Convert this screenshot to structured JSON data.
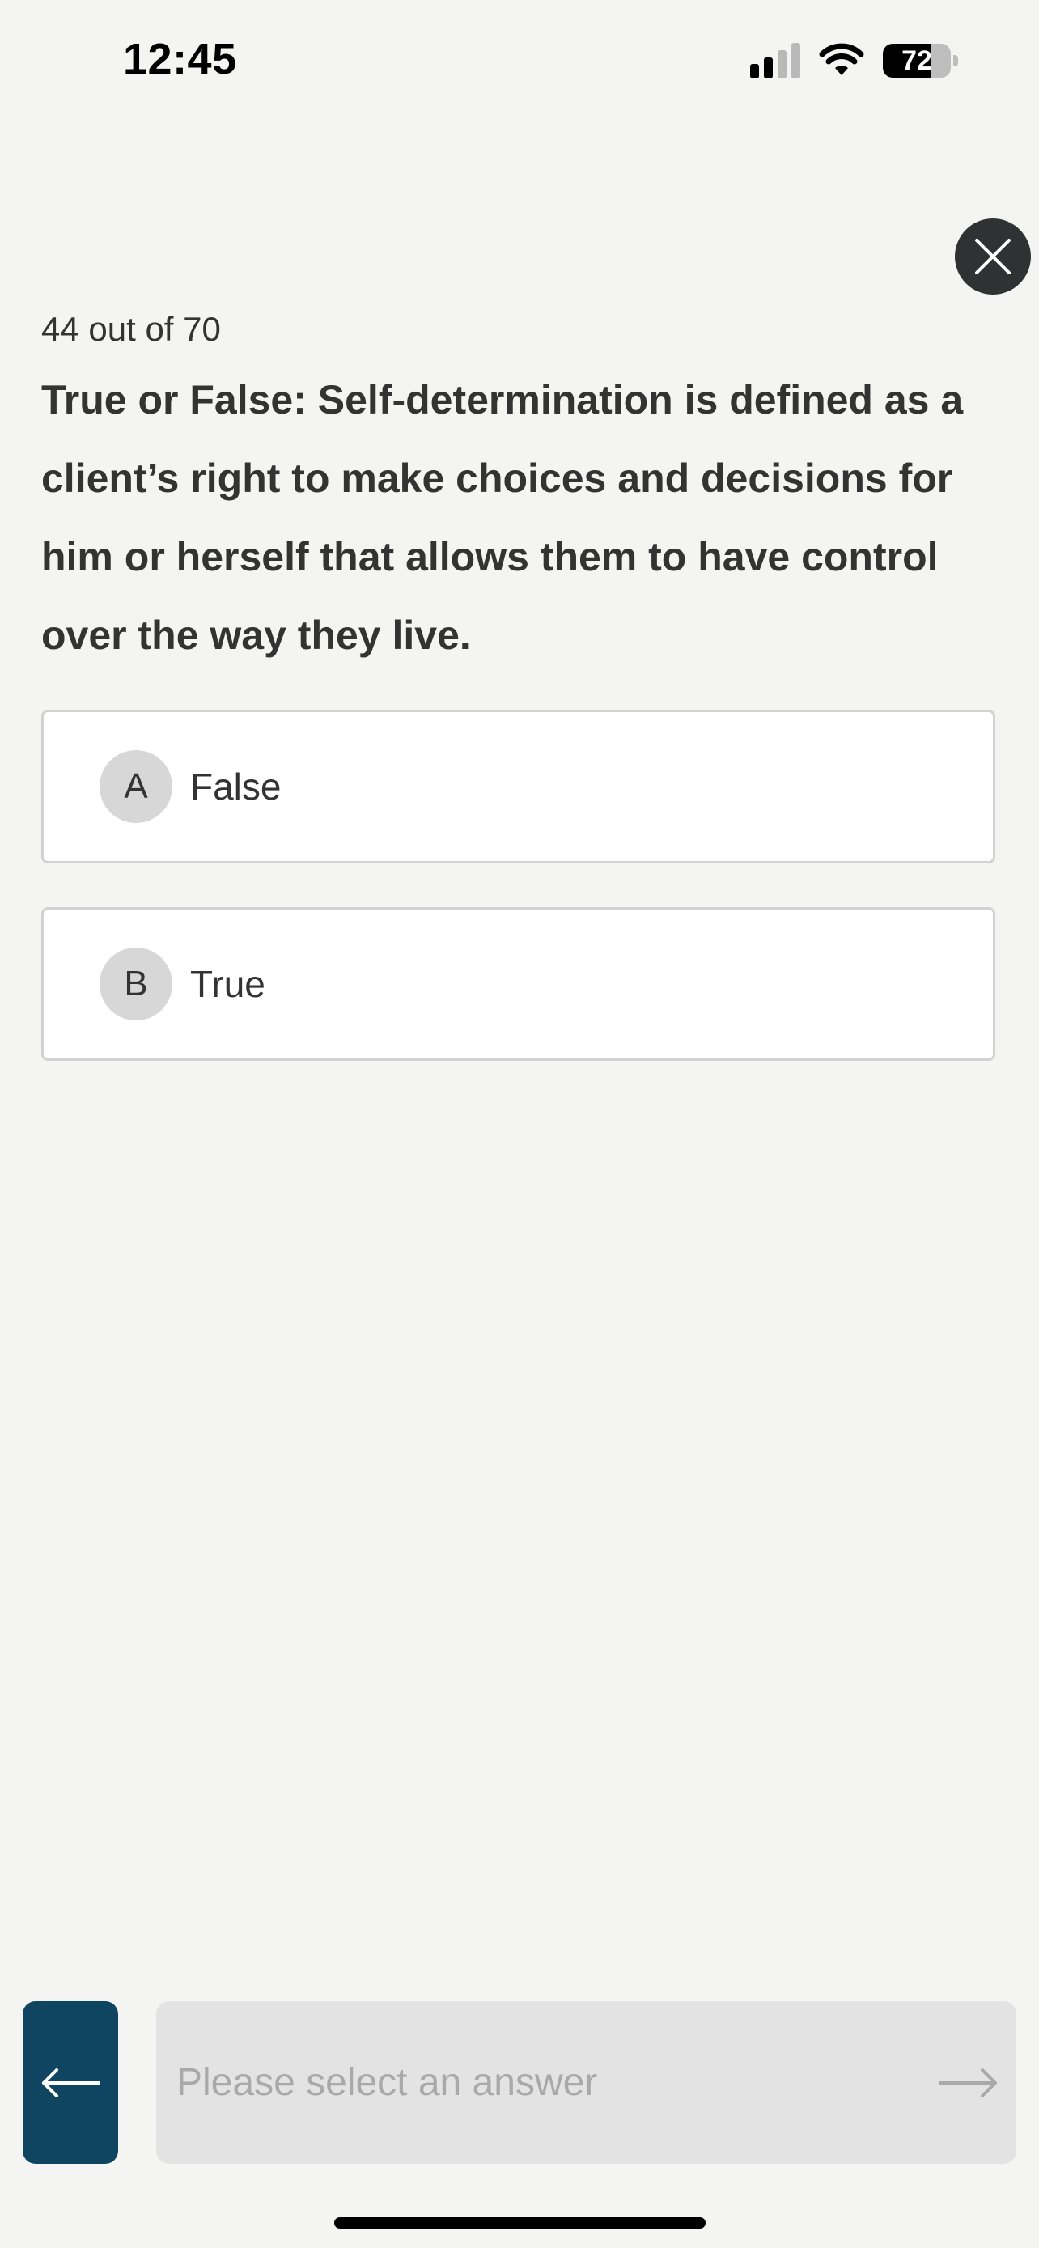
{
  "status_bar": {
    "time": "12:45",
    "battery": "72",
    "battery_level": 0.72,
    "signal_bars_active": 2,
    "signal_bars_total": 4
  },
  "quiz": {
    "progress": "44 out of 70",
    "question": "True or False: Self-determination is defined as a client’s right to make choices and decisions for him or herself that allows them to have control over the way they live.",
    "options": [
      {
        "letter": "A",
        "label": "False"
      },
      {
        "letter": "B",
        "label": "True"
      }
    ]
  },
  "navigation": {
    "next_label": "Please select an answer"
  },
  "icons": {
    "close": "close-icon",
    "back": "arrow-left-icon",
    "next": "arrow-right-icon",
    "signal": "cellular-signal-icon",
    "wifi": "wifi-icon",
    "battery": "battery-icon"
  },
  "colors": {
    "background": "#f4f4f3",
    "back_button": "#0f4560",
    "close_button": "#2f3133",
    "next_button_disabled": "#e3e3e3",
    "option_letter_bg": "#d7d7d7"
  }
}
